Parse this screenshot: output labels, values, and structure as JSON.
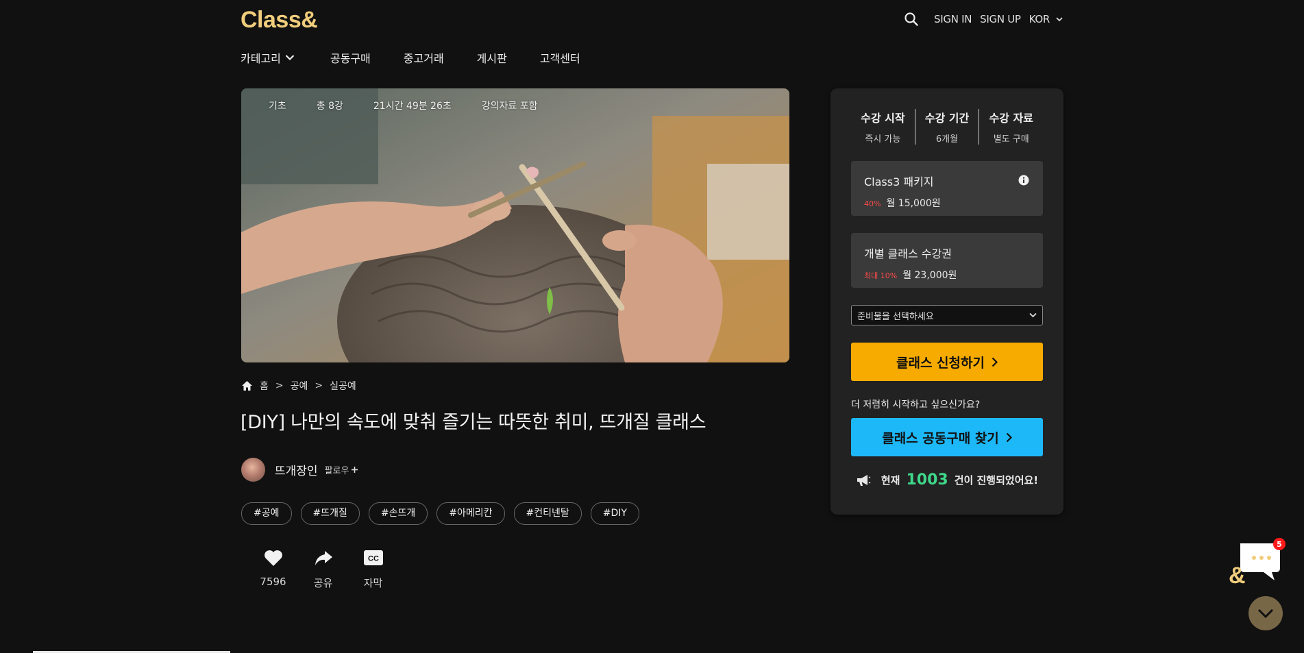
{
  "header": {
    "logo": "Class&",
    "sign_in": "SIGN IN",
    "sign_up": "SIGN UP",
    "language": "KOR"
  },
  "nav": {
    "items": [
      "카테고리",
      "공동구매",
      "중고거래",
      "게시판",
      "고객센터"
    ]
  },
  "hero": {
    "level": "기초",
    "lectures": "총 8강",
    "duration": "21시간 49분 26초",
    "materials": "강의자료 포함"
  },
  "breadcrumb": [
    "홈",
    ">",
    "공예",
    ">",
    "실공예"
  ],
  "title": "[DIY] 나만의 속도에 맞춰 즐기는 따뜻한 취미, 뜨개질 클래스",
  "author": {
    "name": "뜨개장인",
    "follow": "팔로우"
  },
  "tags": [
    "#공예",
    "#뜨개질",
    "#손뜨개",
    "#아메리칸",
    "#컨티넨탈",
    "#DIY"
  ],
  "actions": {
    "like_count": "7596",
    "share": "공유",
    "subtitle": "자막"
  },
  "sidebar": {
    "stats": [
      {
        "title": "수강 시작",
        "value": "즉시 가능"
      },
      {
        "title": "수강 기간",
        "value": "6개월"
      },
      {
        "title": "수강 자료",
        "value": "별도 구매"
      }
    ],
    "package": {
      "title": "Class3 패키지",
      "discount": "40%",
      "price": "월 15,000원"
    },
    "single": {
      "title": "개별 클래스 수강권",
      "discount": "최대 10%",
      "price": "월 23,000원"
    },
    "select_placeholder": "준비물을 선택하세요",
    "apply_button": "클래스 신청하기",
    "cheaper_text": "더 저렴히 시작하고 싶으신가요?",
    "group_button": "클래스 공동구매 찾기",
    "progress_prefix": "현재",
    "progress_count": "1003",
    "progress_suffix": "건이 진행되었어요!"
  },
  "chat": {
    "badge": "5"
  },
  "colors": {
    "logo": "#f0cd7c",
    "apply": "#f7ab00",
    "group": "#1db8f7",
    "discount": "#ff4a4a",
    "count": "#3ed88a"
  }
}
